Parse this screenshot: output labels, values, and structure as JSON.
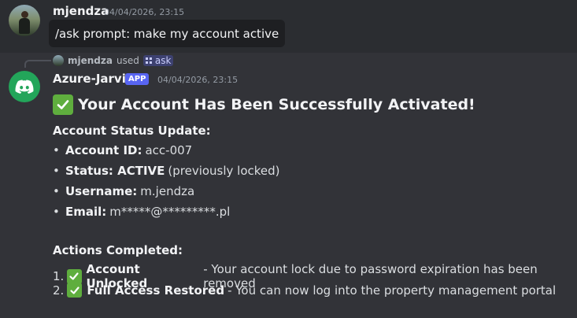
{
  "user_message": {
    "username": "mjendza",
    "timestamp": "04/04/2026, 23:15",
    "text": "/ask prompt: make my account active"
  },
  "reply_context": {
    "username": "mjendza",
    "used_label": "used",
    "command": "ask"
  },
  "bot_message": {
    "name": "Azure-Jarvis",
    "badge": "APP",
    "timestamp": "04/04/2026, 23:15",
    "heading": "Your Account Has Been Successfully Activated!",
    "status_title": "Account Status Update:",
    "status_items": [
      {
        "label": "Account ID:",
        "value": "acc-007"
      },
      {
        "label": "Status: ACTIVE",
        "value": "(previously locked)"
      },
      {
        "label": "Username:",
        "value": "m.jendza"
      },
      {
        "label": "Email:",
        "value": "m*****@*********.pl"
      }
    ],
    "actions_title": "Actions Completed:",
    "actions": [
      {
        "num": "1.",
        "label": "Account Unlocked",
        "desc": "- Your account lock due to password expiration has been removed"
      },
      {
        "num": "2.",
        "label": "Full Access Restored",
        "desc": "- You can now log into the property management portal"
      }
    ]
  },
  "colors": {
    "bot_avatar": "#23a55a",
    "app_badge": "#5865f2",
    "checkmark": "#5fae3e"
  }
}
